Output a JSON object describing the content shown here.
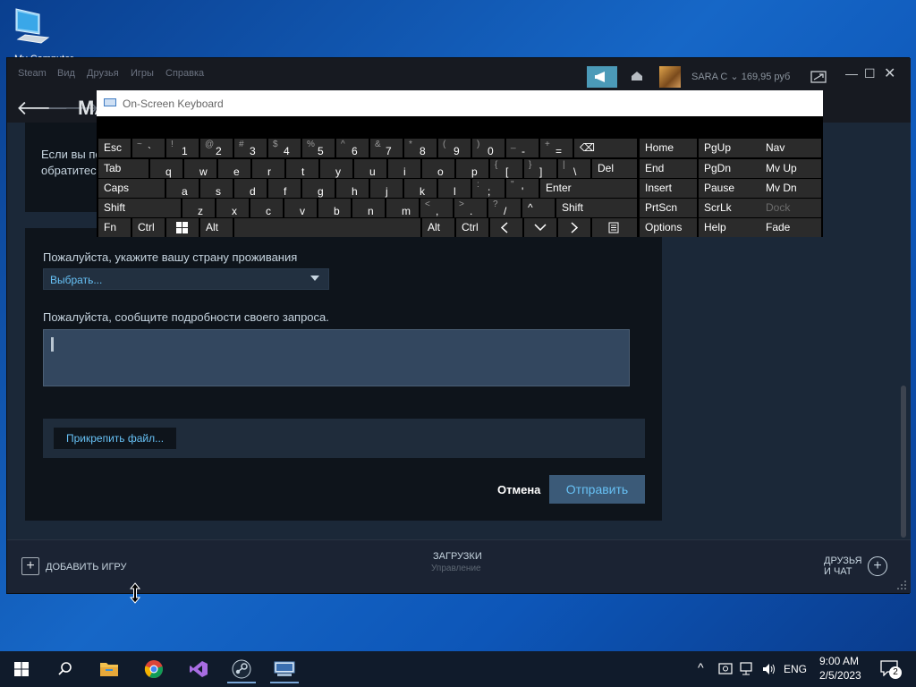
{
  "desktop": {
    "icon_label": "My Computer"
  },
  "steam": {
    "menu": [
      "Steam",
      "Вид",
      "Друзья",
      "Игры",
      "Справка"
    ],
    "page_title": "МА",
    "user": {
      "name": "SARA C",
      "balance": "169,95 руб"
    },
    "top_text": [
      "Если вы по",
      "обратитес"
    ],
    "country_label": "Пожалуйста, укажите вашу страну проживания",
    "country_select": "Выбрать...",
    "details_label": "Пожалуйста, сообщите подробности своего запроса.",
    "attach_label": "Прикрепить файл...",
    "cancel_label": "Отмена",
    "send_label": "Отправить",
    "footer": {
      "add_game": "ДОБАВИТЬ ИГРУ",
      "downloads": "ЗАГРУЗКИ",
      "manage": "Управление",
      "friends_line1": "ДРУЗЬЯ",
      "friends_line2": "И ЧАТ"
    }
  },
  "osk": {
    "title": "On-Screen Keyboard",
    "keys": {
      "esc": "Esc",
      "r1": [
        [
          "~",
          "`"
        ],
        [
          "!",
          "1"
        ],
        [
          "@",
          "2"
        ],
        [
          "#",
          "3"
        ],
        [
          "$",
          "4"
        ],
        [
          "%",
          "5"
        ],
        [
          "^",
          "6"
        ],
        [
          "&",
          "7"
        ],
        [
          "*",
          "8"
        ],
        [
          "(",
          "9"
        ],
        [
          ")",
          "0"
        ],
        [
          "_",
          "-"
        ],
        [
          "+",
          "="
        ]
      ],
      "backspace": "⌫",
      "tab": "Tab",
      "r2": [
        "q",
        "w",
        "e",
        "r",
        "t",
        "y",
        "u",
        "i",
        "o",
        "p"
      ],
      "r2_sym": [
        [
          "{",
          "["
        ],
        [
          "}",
          "]"
        ],
        [
          "|",
          "\\"
        ]
      ],
      "del": "Del",
      "caps": "Caps",
      "r3": [
        "a",
        "s",
        "d",
        "f",
        "g",
        "h",
        "j",
        "k",
        "l"
      ],
      "r3_sym": [
        [
          ":",
          ";"
        ],
        [
          "\"",
          "'"
        ]
      ],
      "enter": "Enter",
      "shift": "Shift",
      "r4": [
        "z",
        "x",
        "c",
        "v",
        "b",
        "n",
        "m"
      ],
      "r4_sym": [
        [
          "<",
          ","
        ],
        [
          ">",
          "."
        ],
        [
          "?",
          "/"
        ]
      ],
      "up": "^",
      "fn": "Fn",
      "ctrl": "Ctrl",
      "alt": "Alt",
      "nav_cols": [
        [
          "Home",
          "PgUp",
          "Nav"
        ],
        [
          "End",
          "PgDn",
          "Mv Up"
        ],
        [
          "Insert",
          "Pause",
          "Mv Dn"
        ],
        [
          "PrtScn",
          "ScrLk",
          "Dock"
        ],
        [
          "Options",
          "Help",
          "Fade"
        ]
      ]
    }
  },
  "taskbar": {
    "lang": "ENG",
    "time": "9:00 AM",
    "date": "2/5/2023",
    "notifications": "2"
  }
}
